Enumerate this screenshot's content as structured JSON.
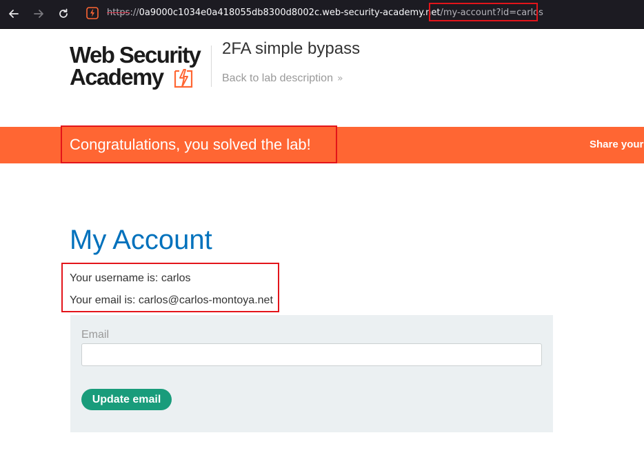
{
  "browser": {
    "back_icon": "arrow-left-icon",
    "forward_icon": "arrow-right-icon",
    "reload_icon": "reload-icon",
    "url_scheme": "https",
    "url_separator": "://",
    "url_host": "0a9000c1034e0a418055db8300d8002c.web-security-academy.net",
    "url_path": "/my-account?id=carlos"
  },
  "header": {
    "logo_line1": "Web Security",
    "logo_line2": "Academy",
    "lab_title": "2FA simple bypass",
    "back_link": "Back to lab description",
    "back_chevron": "»"
  },
  "banner": {
    "message": "Congratulations, you solved the lab!",
    "share": "Share your"
  },
  "account": {
    "heading": "My Account",
    "username_line": "Your username is: carlos",
    "email_line": "Your email is: carlos@carlos-montoya.net",
    "email_label": "Email",
    "email_value": "",
    "update_button": "Update email"
  },
  "colors": {
    "accent_orange": "#ff6633",
    "heading_blue": "#0071bc",
    "button_green": "#199c7b",
    "highlight_red": "#e3141a"
  }
}
